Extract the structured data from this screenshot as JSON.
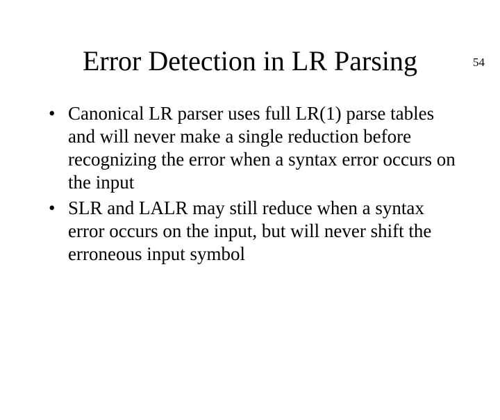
{
  "page_number": "54",
  "title": "Error Detection in LR Parsing",
  "bullets": [
    "Canonical LR parser uses full LR(1) parse tables and will never make a single reduction before recognizing the error when a syntax error occurs on the input",
    "SLR and LALR may still reduce when a syntax error occurs on the input, but will never shift the erroneous input symbol"
  ]
}
